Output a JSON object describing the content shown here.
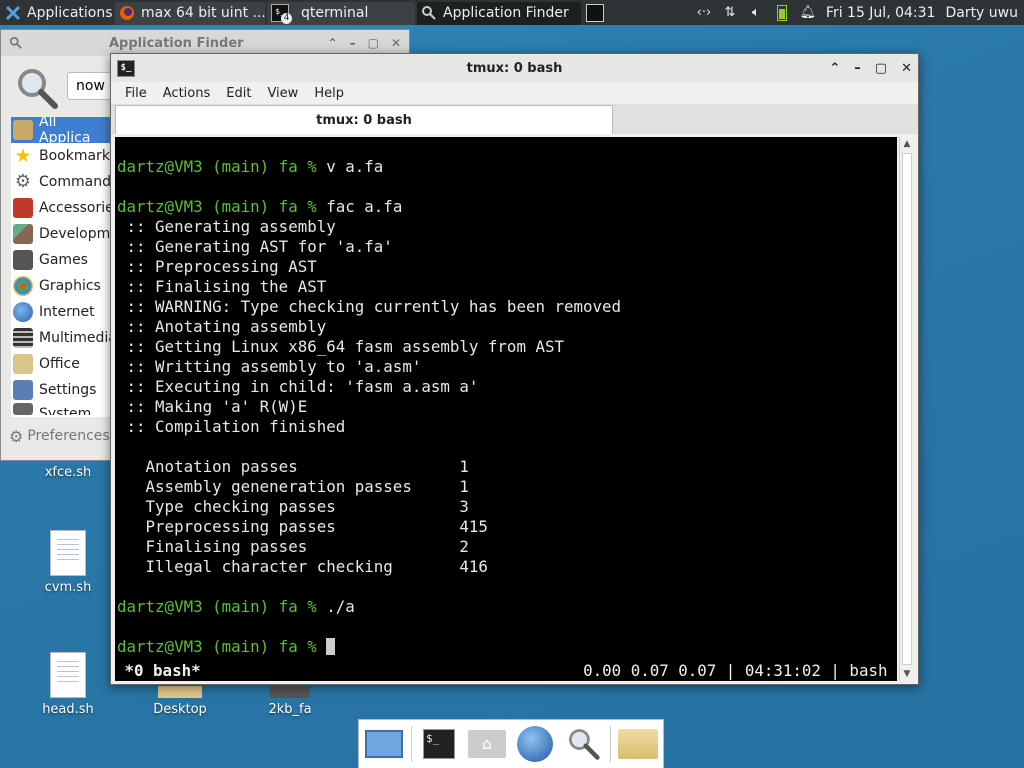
{
  "panel": {
    "applications_label": "Applications",
    "tasks": [
      {
        "label": "max 64 bit uint ..."
      },
      {
        "label": "qterminal",
        "badge": "4"
      },
      {
        "label": "Application Finder"
      }
    ],
    "clock": "Fri 15 Jul, 04:31",
    "user": "Darty uwu"
  },
  "desktop": {
    "icons": [
      {
        "label": "xfce.sh"
      },
      {
        "label": "cvm.sh"
      },
      {
        "label": "head.sh"
      },
      {
        "label": "Desktop"
      },
      {
        "label": "2kb_fa"
      }
    ]
  },
  "finder": {
    "title": "Application Finder",
    "search_value": "now r",
    "categories": [
      {
        "label": "All Applica",
        "icon": "all-apps-icon"
      },
      {
        "label": "Bookmarks",
        "icon": "star-icon"
      },
      {
        "label": "Commands",
        "icon": "gears-icon"
      },
      {
        "label": "Accessorie",
        "icon": "tools-icon"
      },
      {
        "label": "Developme",
        "icon": "brush-icon"
      },
      {
        "label": "Games",
        "icon": "joystick-icon"
      },
      {
        "label": "Graphics",
        "icon": "palette-icon"
      },
      {
        "label": "Internet",
        "icon": "globe-icon"
      },
      {
        "label": "Multimedia",
        "icon": "film-icon"
      },
      {
        "label": "Office",
        "icon": "office-icon"
      },
      {
        "label": "Settings",
        "icon": "settings-icon"
      },
      {
        "label": "System",
        "icon": "system-icon"
      }
    ],
    "preferences_label": "Preferences"
  },
  "terminal": {
    "title": "tmux: 0 bash",
    "menu": [
      "File",
      "Actions",
      "Edit",
      "View",
      "Help"
    ],
    "tab_label": "tmux: 0 bash",
    "prompt": "dartz@VM3 (main) fa %",
    "lines": [
      {
        "type": "blank",
        "text": ""
      },
      {
        "type": "prompt",
        "text": " v a.fa"
      },
      {
        "type": "blank",
        "text": ""
      },
      {
        "type": "prompt",
        "text": " fac a.fa"
      },
      {
        "type": "out",
        "text": " :: Generating assembly"
      },
      {
        "type": "out",
        "text": " :: Generating AST for 'a.fa'"
      },
      {
        "type": "out",
        "text": " :: Preprocessing AST"
      },
      {
        "type": "out",
        "text": " :: Finalising the AST"
      },
      {
        "type": "out",
        "text": " :: WARNING: Type checking currently has been removed"
      },
      {
        "type": "out",
        "text": " :: Anotating assembly"
      },
      {
        "type": "out",
        "text": " :: Getting Linux x86_64 fasm assembly from AST"
      },
      {
        "type": "out",
        "text": " :: Writting assembly to 'a.asm'"
      },
      {
        "type": "out",
        "text": " :: Executing in child: 'fasm a.asm a'"
      },
      {
        "type": "out",
        "text": " :: Making 'a' R(W)E"
      },
      {
        "type": "out",
        "text": " :: Compilation finished"
      },
      {
        "type": "blank",
        "text": ""
      },
      {
        "type": "out",
        "text": "   Anotation passes                 1"
      },
      {
        "type": "out",
        "text": "   Assembly geneneration passes     1"
      },
      {
        "type": "out",
        "text": "   Type checking passes             3"
      },
      {
        "type": "out",
        "text": "   Preprocessing passes             415"
      },
      {
        "type": "out",
        "text": "   Finalising passes                2"
      },
      {
        "type": "out",
        "text": "   Illegal character checking       416"
      },
      {
        "type": "blank",
        "text": ""
      },
      {
        "type": "prompt",
        "text": " ./a"
      },
      {
        "type": "blank",
        "text": ""
      },
      {
        "type": "prompt-cursor",
        "text": " "
      }
    ],
    "status_left": " *0 bash*",
    "status_right": "0.00 0.07 0.07 | 04:31:02 | bash "
  },
  "dock": {
    "items": [
      {
        "icon": "show-desktop-icon"
      },
      {
        "icon": "terminal-icon"
      },
      {
        "icon": "home-folder-icon"
      },
      {
        "icon": "web-browser-icon"
      },
      {
        "icon": "app-finder-icon"
      },
      {
        "icon": "folder-icon"
      }
    ]
  }
}
